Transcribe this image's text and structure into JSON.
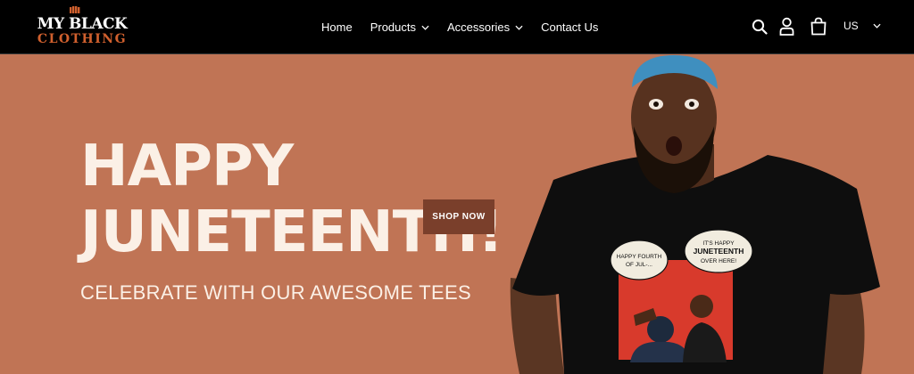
{
  "brand": {
    "line1": "MY BLACK",
    "line2": "CLOTHING",
    "icon": "fist-logo-icon",
    "accent": "#d0602e"
  },
  "nav": {
    "items": [
      {
        "label": "Home",
        "has_dropdown": false
      },
      {
        "label": "Products",
        "has_dropdown": true
      },
      {
        "label": "Accessories",
        "has_dropdown": true
      },
      {
        "label": "Contact Us",
        "has_dropdown": false
      }
    ]
  },
  "header_icons": [
    "search-icon",
    "account-icon",
    "cart-icon"
  ],
  "currency": {
    "label": "US"
  },
  "hero": {
    "headline_line1": "HAPPY",
    "headline_line2": "JUNETEENTH!",
    "subheadline": "CELEBRATE WITH OUR AWESOME TEES",
    "cta_label": "SHOP NOW",
    "background": "#c07455",
    "cta_color": "#7a3f2b"
  },
  "tshirt_print": {
    "bubble_left": "HAPPY FOURTH OF JUL-...",
    "bubble_right_line1": "IT'S HAPPY",
    "bubble_right_line2": "JUNETEENTH",
    "bubble_right_line3": "OVER HERE!"
  }
}
